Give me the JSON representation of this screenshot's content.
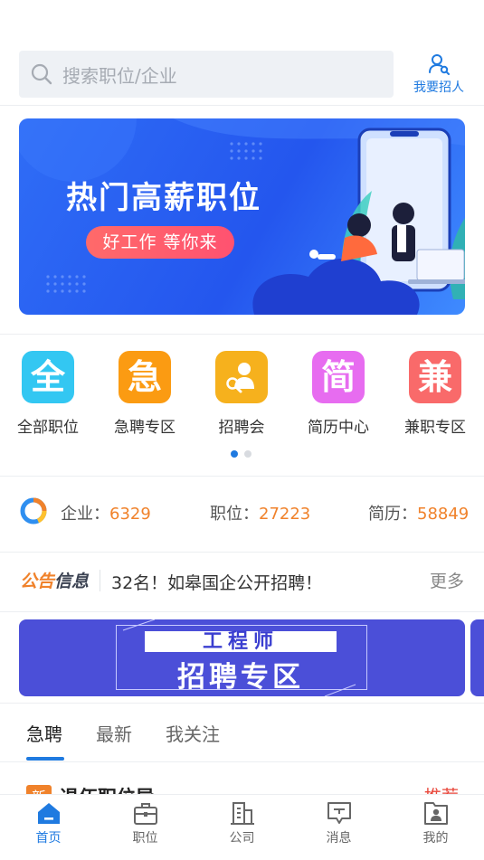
{
  "search": {
    "placeholder": "搜索职位/企业",
    "icon": "search-icon"
  },
  "header": {
    "recruit_label": "我要招人",
    "recruit_icon": "user-search-icon",
    "accent": "#1f7ae0"
  },
  "banner": {
    "title": "热门高薪职位",
    "subtitle": "好工作 等你来"
  },
  "categories": [
    {
      "glyph": "全",
      "label": "全部职位",
      "color": "#33c7f2"
    },
    {
      "glyph": "急",
      "label": "急聘专区",
      "color": "#fb9b12"
    },
    {
      "glyph": "",
      "label": "招聘会",
      "color": "#f6b11d",
      "icon": "person-search-icon"
    },
    {
      "glyph": "简",
      "label": "简历中心",
      "color": "#e76cf0"
    },
    {
      "glyph": "兼",
      "label": "兼职专区",
      "color": "#f96a6a"
    }
  ],
  "carousel": {
    "pages": 2,
    "active": 0
  },
  "stats": [
    {
      "label": "企业：",
      "value": "6329"
    },
    {
      "label": "职位：",
      "value": "27223"
    },
    {
      "label": "简历：",
      "value": "58849"
    }
  ],
  "notice": {
    "brand_a": "公告",
    "brand_b": "信息",
    "text": "32名！如皋国企公开招聘！",
    "more": "更多"
  },
  "engineer_banner": {
    "line1": "工程师",
    "line2": "招聘专区"
  },
  "tabs": [
    {
      "label": "急聘",
      "active": true
    },
    {
      "label": "最新",
      "active": false
    },
    {
      "label": "我关注",
      "active": false
    }
  ],
  "list_peek": {
    "badge": "新",
    "title": "退伍职位导",
    "tag": "推荐"
  },
  "bottom_nav": [
    {
      "label": "首页",
      "icon": "home-icon",
      "active": true
    },
    {
      "label": "职位",
      "icon": "briefcase-icon",
      "active": false
    },
    {
      "label": "公司",
      "icon": "building-icon",
      "active": false
    },
    {
      "label": "消息",
      "icon": "message-icon",
      "active": false
    },
    {
      "label": "我的",
      "icon": "profile-icon",
      "active": false
    }
  ]
}
